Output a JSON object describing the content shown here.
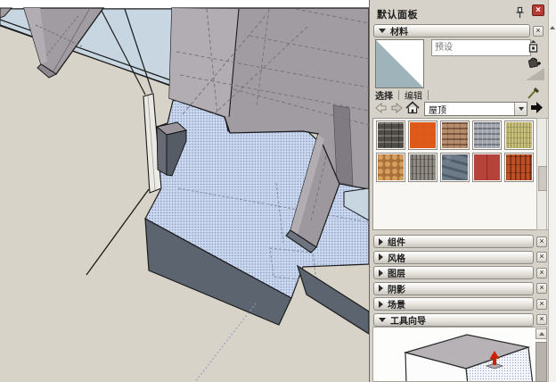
{
  "colors": {
    "ground": "#d8d3c8",
    "plane": "#c7d6e0",
    "mass": "#a19ba2",
    "mass_light": "#b2adb2",
    "beam": "#9d979e",
    "dark_face": "#5c6470",
    "selection_base": "#ccd9ee",
    "selection_dot": "#7e93c1",
    "edge": "#1b1b1b",
    "guide_dots": "#8e9cc0",
    "panel_bg": "#d6d2c9",
    "close_red": "#b53a31"
  },
  "panel": {
    "title": "默认面板",
    "close_glyph": "×",
    "materials": {
      "section_label": "材料",
      "name_placeholder": "预设",
      "tabs": [
        {
          "label": "选择"
        },
        {
          "label": "编辑"
        }
      ],
      "collection_value": "屋顶",
      "swatches": [
        {
          "name": "charcoal-shingles",
          "pattern": "shingle",
          "c1": "#4f4b47",
          "c2": "#847f78"
        },
        {
          "name": "orange-scallop-tiles",
          "pattern": "scallop",
          "c1": "#dd5a1b",
          "c2": "#9c3a0e"
        },
        {
          "name": "brown-shingles",
          "pattern": "strips",
          "c1": "#b68c6d",
          "c2": "#7e5a42"
        },
        {
          "name": "gray-slate-shingles",
          "pattern": "strips",
          "c1": "#a3a6ad",
          "c2": "#6f7680"
        },
        {
          "name": "khaki-thatch",
          "pattern": "vlines",
          "c1": "#c9c07e",
          "c2": "#989050"
        },
        {
          "name": "tan-cobble-tiles",
          "pattern": "cobble",
          "c1": "#d79e60",
          "c2": "#a96f38"
        },
        {
          "name": "gray-wood-shakes",
          "pattern": "vlines",
          "c1": "#918d86",
          "c2": "#5f5c55"
        },
        {
          "name": "blue-slate",
          "pattern": "slate",
          "c1": "#6d7b88",
          "c2": "#515e6a"
        },
        {
          "name": "red-metal-panels",
          "pattern": "panel",
          "c1": "#b5433a",
          "c2": "#8a2d26"
        },
        {
          "name": "spanish-barrel-tiles",
          "pattern": "barrel",
          "c1": "#bc4f25",
          "c2": "#762b10"
        }
      ]
    },
    "sections": [
      {
        "label": "组件",
        "expanded": false
      },
      {
        "label": "风格",
        "expanded": false
      },
      {
        "label": "图层",
        "expanded": false
      },
      {
        "label": "阴影",
        "expanded": false
      },
      {
        "label": "场景",
        "expanded": false
      },
      {
        "label": "工具向导",
        "expanded": true
      }
    ]
  }
}
